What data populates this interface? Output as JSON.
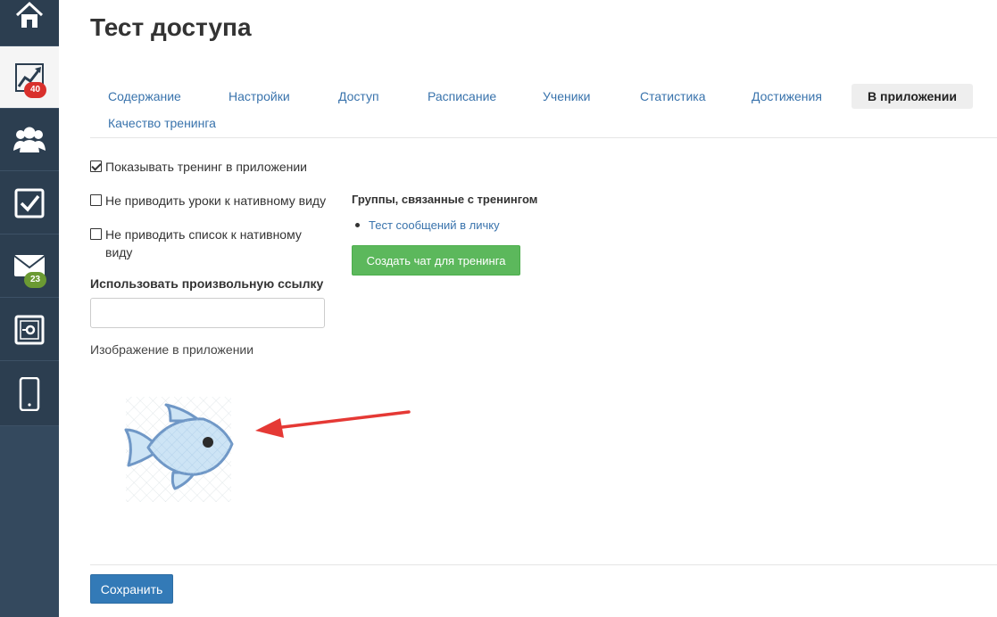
{
  "page": {
    "title": "Тест доступа"
  },
  "sidebar": {
    "items": [
      {
        "icon": "home-icon"
      },
      {
        "icon": "chart-icon",
        "badge": "40",
        "active": true
      },
      {
        "icon": "users-icon"
      },
      {
        "icon": "checkbox-icon"
      },
      {
        "icon": "mail-icon",
        "badge": "23"
      },
      {
        "icon": "safe-icon"
      },
      {
        "icon": "phone-icon"
      }
    ],
    "badge_colors": {
      "red": "#d9302c",
      "green": "#6b9a33"
    }
  },
  "tabs": [
    {
      "label": "Содержание"
    },
    {
      "label": "Настройки"
    },
    {
      "label": "Доступ"
    },
    {
      "label": "Расписание"
    },
    {
      "label": "Ученики"
    },
    {
      "label": "Статистика"
    },
    {
      "label": "Достижения"
    },
    {
      "label": "В приложении",
      "active": true
    },
    {
      "label": "Качество тренинга"
    }
  ],
  "settings": {
    "show_in_app": {
      "label": "Показывать тренинг в приложении",
      "checked": true
    },
    "no_native_lessons": {
      "label": "Не приводить уроки к нативному виду",
      "checked": false
    },
    "no_native_list": {
      "label": "Не приводить список к нативному виду",
      "checked": false
    },
    "custom_link": {
      "label": "Использовать произвольную ссылку",
      "value": ""
    },
    "image_label": "Изображение в приложении"
  },
  "groups": {
    "title": "Группы, связанные с тренингом",
    "items": [
      {
        "label": "Тест сообщений в личку"
      }
    ],
    "create_button": "Создать чат для тренинга"
  },
  "footer": {
    "save_button": "Сохранить"
  },
  "colors": {
    "link": "#3973ac",
    "accent_green": "#5cb85c",
    "accent_blue": "#337ab7",
    "sidebar": "#2c3e50",
    "arrow": "#e53935"
  }
}
